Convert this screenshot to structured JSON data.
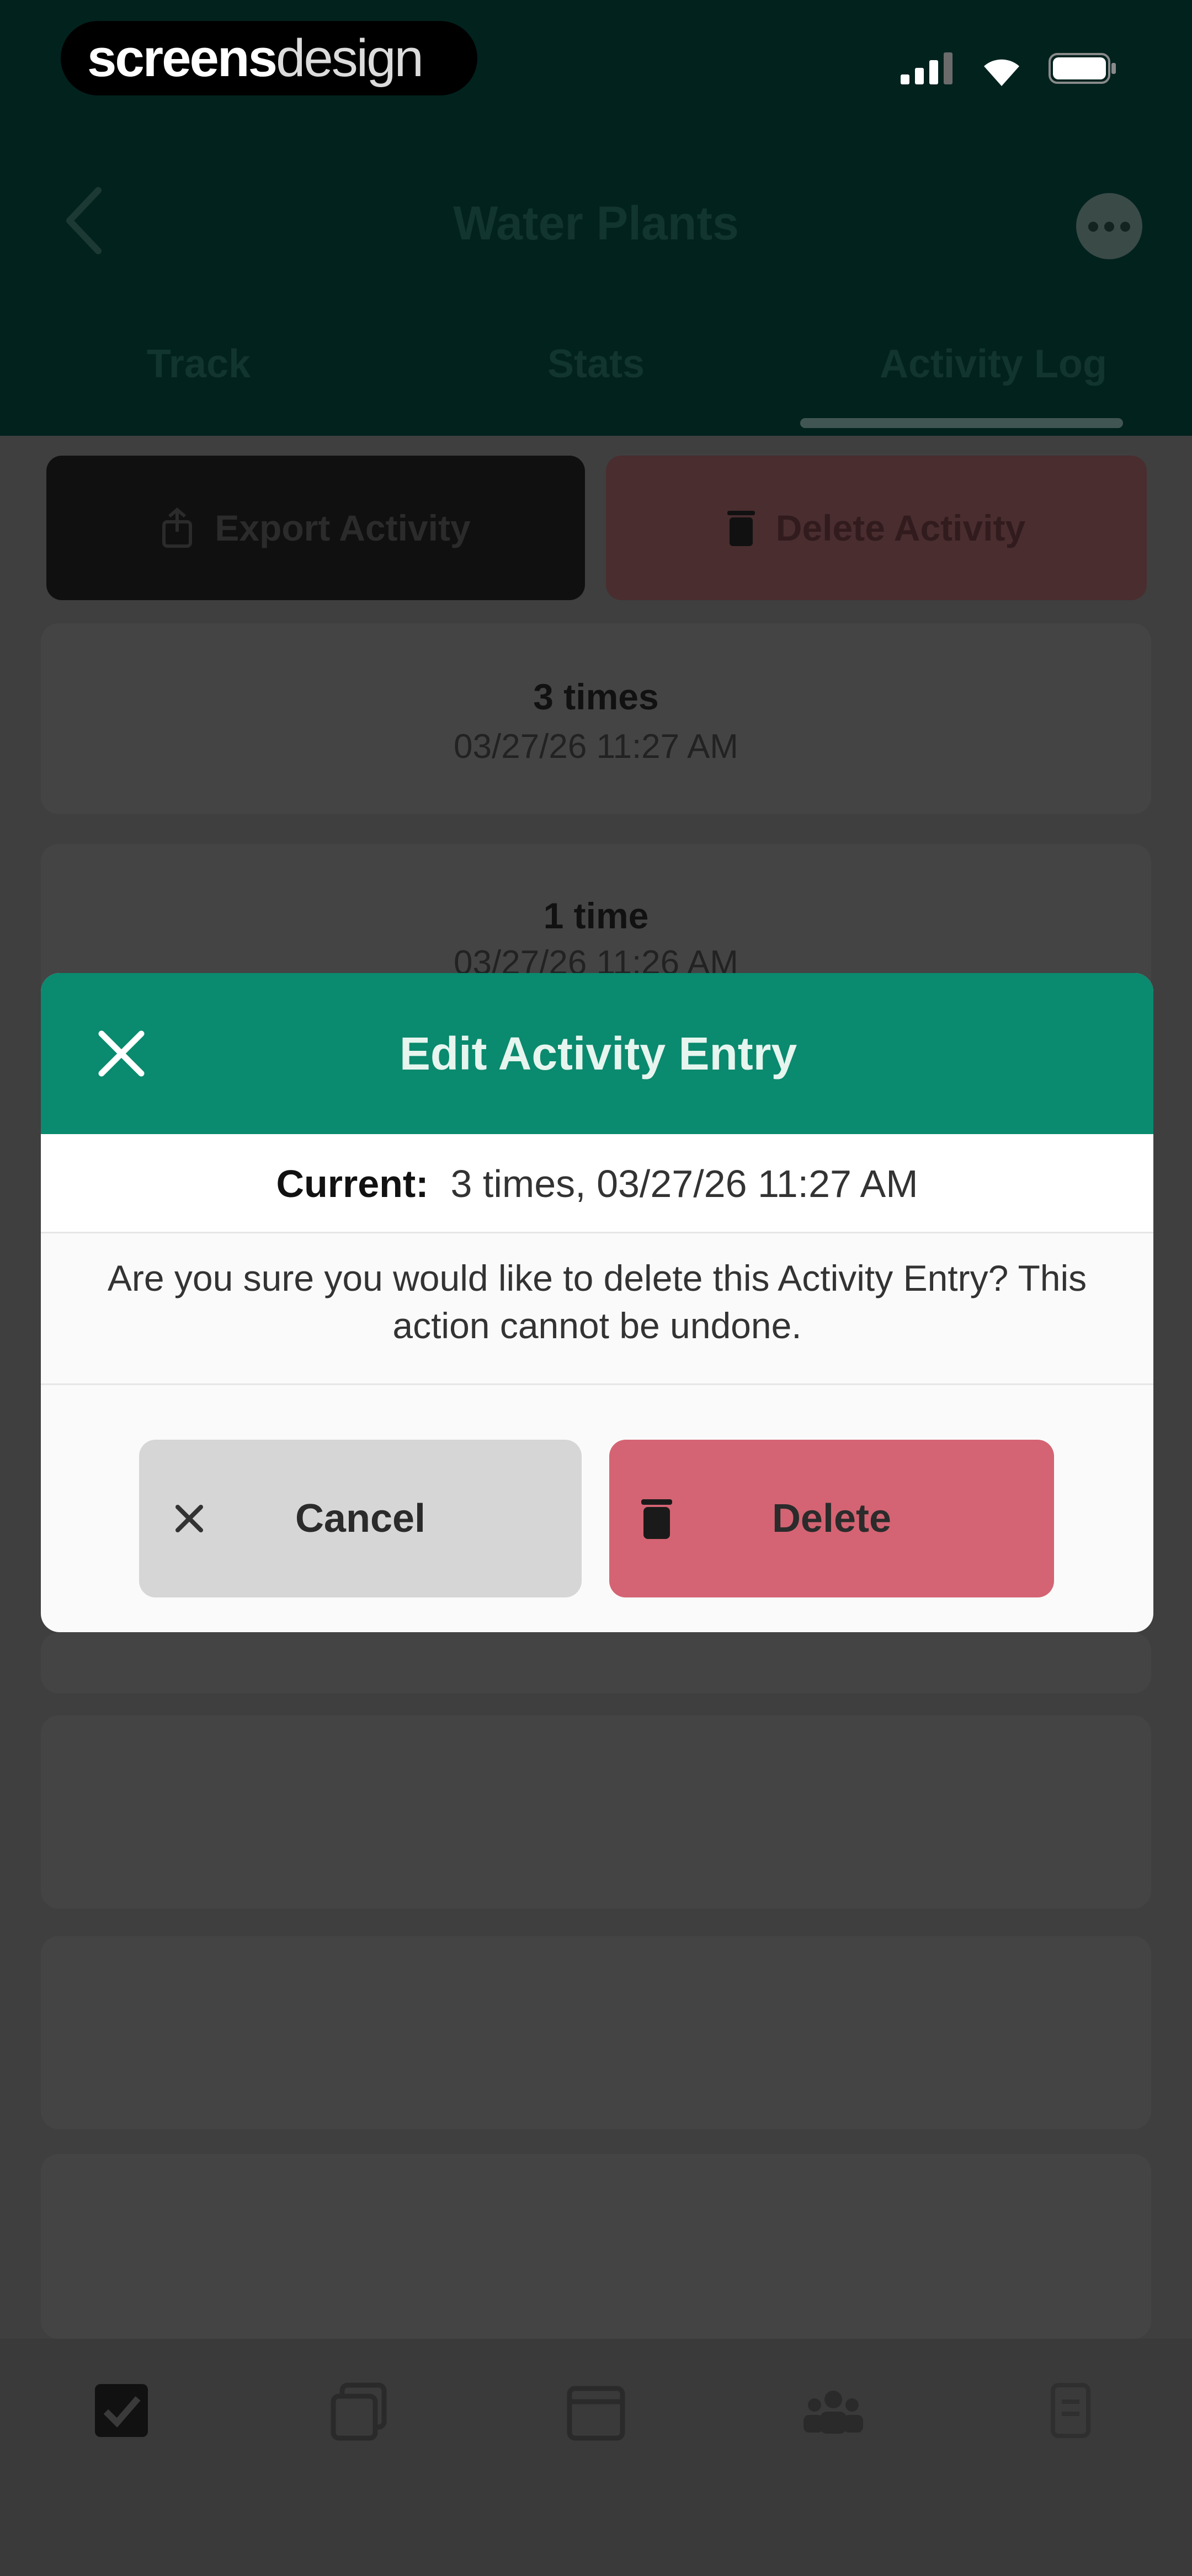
{
  "status_bar": {
    "brand_part1": "screens",
    "brand_part2": "design"
  },
  "header": {
    "title": "Water Plants",
    "back_icon": "chevron-left-icon",
    "more_icon": "more-dots-icon",
    "tabs": [
      {
        "label": "Track",
        "active": false
      },
      {
        "label": "Stats",
        "active": false
      },
      {
        "label": "Activity Log",
        "active": true
      }
    ]
  },
  "actions": {
    "export_label": "Export Activity",
    "delete_label": "Delete Activity"
  },
  "entries": [
    {
      "title": "3 times",
      "subtitle": "03/27/26 11:27 AM"
    },
    {
      "title": "1 time",
      "subtitle": "03/27/26 11:26 AM"
    }
  ],
  "modal": {
    "title": "Edit Activity Entry",
    "current_label": "Current:",
    "current_value": "3 times, 03/27/26 11:27 AM",
    "message": "Are you sure you would like to delete this Activity Entry? This action cannot be undone.",
    "cancel_label": "Cancel",
    "delete_label": "Delete"
  },
  "bottom_nav": {
    "items": [
      "checkbox-icon",
      "copy-icon",
      "calendar-icon",
      "groups-icon",
      "settings-icon"
    ]
  },
  "colors": {
    "header_bg": "#02221e",
    "modal_header": "#0a8a6e",
    "delete_button": "#d46473",
    "cancel_button": "#d6d6d6",
    "overlay": "#3f3f3f"
  }
}
